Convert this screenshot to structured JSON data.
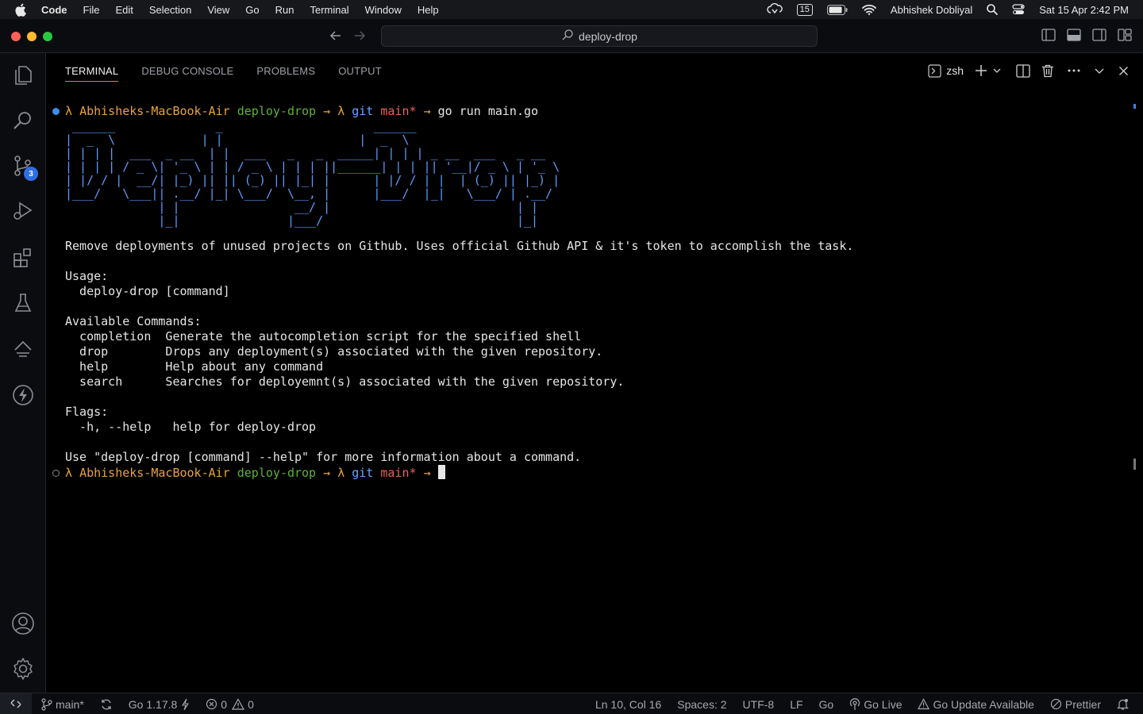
{
  "menubar": {
    "app": "Code",
    "items": [
      "File",
      "Edit",
      "Selection",
      "View",
      "Go",
      "Run",
      "Terminal",
      "Window",
      "Help"
    ],
    "badge": "15",
    "user": "Abhishek Dobliyal",
    "datetime": "Sat 15 Apr  2:42 PM"
  },
  "titlebar": {
    "search": "deploy-drop"
  },
  "activity": {
    "scm_badge": "3"
  },
  "panel": {
    "tabs": [
      "TERMINAL",
      "DEBUG CONSOLE",
      "PROBLEMS",
      "OUTPUT"
    ],
    "shell": "zsh"
  },
  "terminal": {
    "prompt": {
      "lambda": "λ",
      "host": "Abhisheks-MacBook-Air",
      "dir": "deploy-drop",
      "arrow": "→",
      "git": "git",
      "branch": "main*"
    },
    "command": "go run main.go",
    "ascii_art": " ______              _                     ______\n|  _  \\            | |                   |  _  \\\n| | | |  ___  _ __  | |  ___   _   _  _____| | | | _ __  ___   _ __\n| | | | / _ \\| '_ \\ | | / _ \\ | | | ||______| | | || '__|/ _ \\ | '_ \\\n| |/ / |  __/| |_) || || (_) || |_| |      | |/ / | |  | (_) || |_) |\n|___/   \\___|| .__/ |_| \\___/  \\__, |      |___/  |_|   \\___/ | .__/\n             | |                __/ |                          | |\n             |_|               |___/                           |_|",
    "output": [
      "Remove deployments of unused projects on Github. Uses official Github API & it's token to accomplish the task.",
      "",
      "Usage:",
      "  deploy-drop [command]",
      "",
      "Available Commands:",
      "  completion  Generate the autocompletion script for the specified shell",
      "  drop        Drops any deployment(s) associated with the given repository.",
      "  help        Help about any command",
      "  search      Searches for deployemnt(s) associated with the given repository.",
      "",
      "Flags:",
      "  -h, --help   help for deploy-drop",
      "",
      "Use \"deploy-drop [command] --help\" for more information about a command."
    ]
  },
  "statusbar": {
    "branch": "main*",
    "go_version": "Go 1.17.8",
    "errors": "0",
    "warnings": "0",
    "position": "Ln 10, Col 16",
    "spaces": "Spaces: 2",
    "encoding": "UTF-8",
    "eol": "LF",
    "language": "Go",
    "golive": "Go Live",
    "update": "Go Update Available",
    "prettier": "Prettier"
  },
  "colors": {
    "accent_tab": "#e0784b",
    "badge_blue": "#2f6fe4",
    "ascii_blue": "#5c9cff"
  }
}
